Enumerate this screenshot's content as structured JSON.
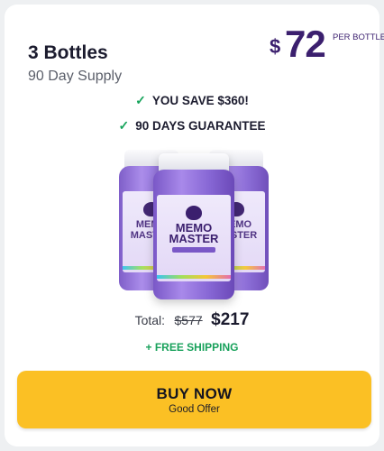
{
  "package": {
    "quantity": "3 Bottles",
    "supply": "90 Day Supply"
  },
  "price": {
    "currency": "$",
    "per_bottle": "72",
    "per_label": "PER BOTTLE"
  },
  "benefits": [
    "YOU SAVE $360!",
    "90 DAYS GUARANTEE"
  ],
  "product": {
    "name_line1": "MEMO",
    "name_line2": "MASTER",
    "bottle_count": 3,
    "colors": {
      "bottle": "#8666d4",
      "label": "#ebe3f9",
      "brand": "#3b1f6e"
    }
  },
  "total": {
    "label": "Total:",
    "old_price": "$577",
    "new_price": "$217"
  },
  "shipping": "+ FREE SHIPPING",
  "cta": {
    "label": "BUY NOW",
    "sublabel": "Good Offer",
    "color": "#fbc024"
  }
}
